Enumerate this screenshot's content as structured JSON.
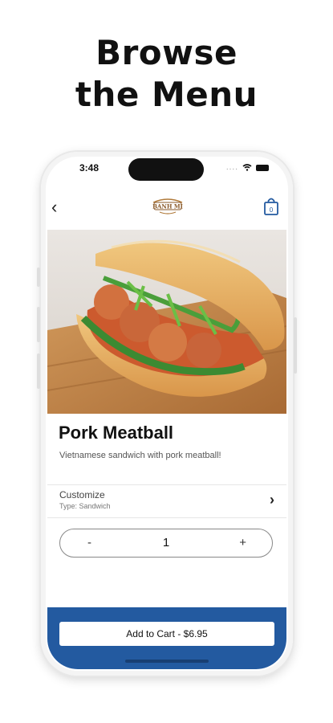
{
  "headline": {
    "line1": "Browse",
    "line2": "the Menu"
  },
  "status_bar": {
    "time": "3:48",
    "signal": "....",
    "wifi_icon": "wifi-icon",
    "battery_icon": "battery-icon"
  },
  "navbar": {
    "back_icon": "chevron-left-icon",
    "back_glyph": "‹",
    "logo_text": "BANH MI",
    "cart_count": "0"
  },
  "product": {
    "name": "Pork Meatball",
    "description": "Vietnamese sandwich with pork meatball!",
    "image_icon": "sandwich-photo"
  },
  "customize": {
    "label": "Customize",
    "sublabel": "Type: Sandwich",
    "chevron": "›"
  },
  "quantity": {
    "minus": "-",
    "value": "1",
    "plus": "+"
  },
  "footer": {
    "add_to_cart_label": "Add to Cart - $6.95"
  },
  "colors": {
    "accent": "#235aa0",
    "text": "#111111"
  }
}
